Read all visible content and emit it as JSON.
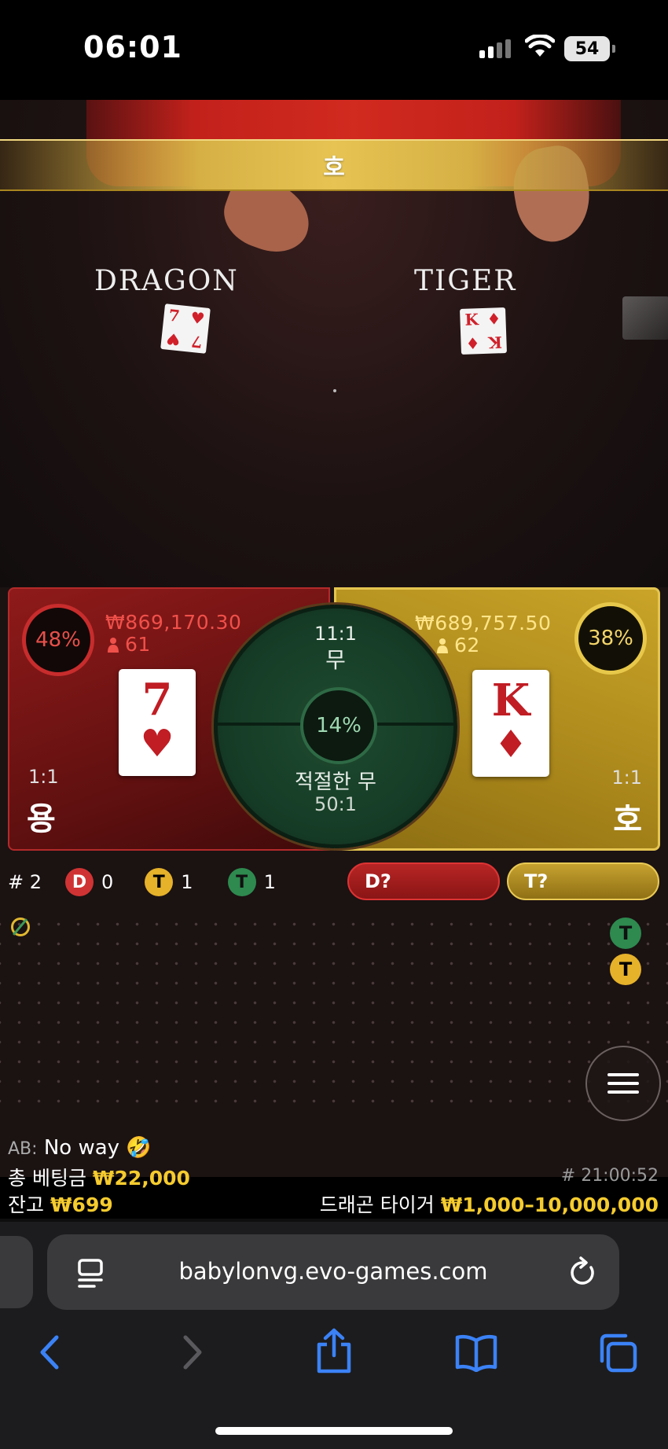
{
  "status_bar": {
    "time": "06:01",
    "battery": "54"
  },
  "video": {
    "banner": "호",
    "dragon_label": "DRAGON",
    "tiger_label": "TIGER",
    "dragon_card": {
      "rank": "7",
      "suit": "♥"
    },
    "tiger_card": {
      "rank": "K",
      "suit": "♦"
    }
  },
  "bet_panel": {
    "dragon": {
      "percent": "48%",
      "amount": "₩869,170.30",
      "players": "61",
      "card_rank": "7",
      "card_suit": "♥",
      "odds": "1:1",
      "name": "용"
    },
    "tiger": {
      "percent": "38%",
      "amount": "₩689,757.50",
      "players": "62",
      "card_rank": "K",
      "card_suit": "♦",
      "odds": "1:1",
      "name": "호"
    },
    "tie": {
      "odds": "11:1",
      "name": "무",
      "percent": "14%",
      "suited_name": "적절한 무",
      "suited_odds": "50:1"
    }
  },
  "stats": {
    "round": "# 2",
    "dragon_letter": "D",
    "dragon_count": "0",
    "tiger_letter": "T",
    "tiger_count": "1",
    "tie_letter": "T",
    "tie_count": "1"
  },
  "side_buttons": {
    "dragon": "D?",
    "tiger": "T?"
  },
  "road": {
    "entries": [
      "T",
      "T"
    ]
  },
  "chat": {
    "name": "AB:",
    "message": "No way 🤣"
  },
  "footer": {
    "total_bet_label": "총 베팅금",
    "total_bet_value": "₩22,000",
    "balance_label": "잔고",
    "balance_value": "₩699",
    "round_id": "# 21:00:52",
    "table_name": "드래곤 타이거",
    "limits": "₩1,000–10,000,000"
  },
  "browser": {
    "url": "babylonvg.evo-games.com"
  },
  "colors": {
    "dragon": "#8f1a1a",
    "tiger": "#c9a428",
    "tie": "#1f4a30",
    "accent_gold": "#f5cb2e"
  }
}
